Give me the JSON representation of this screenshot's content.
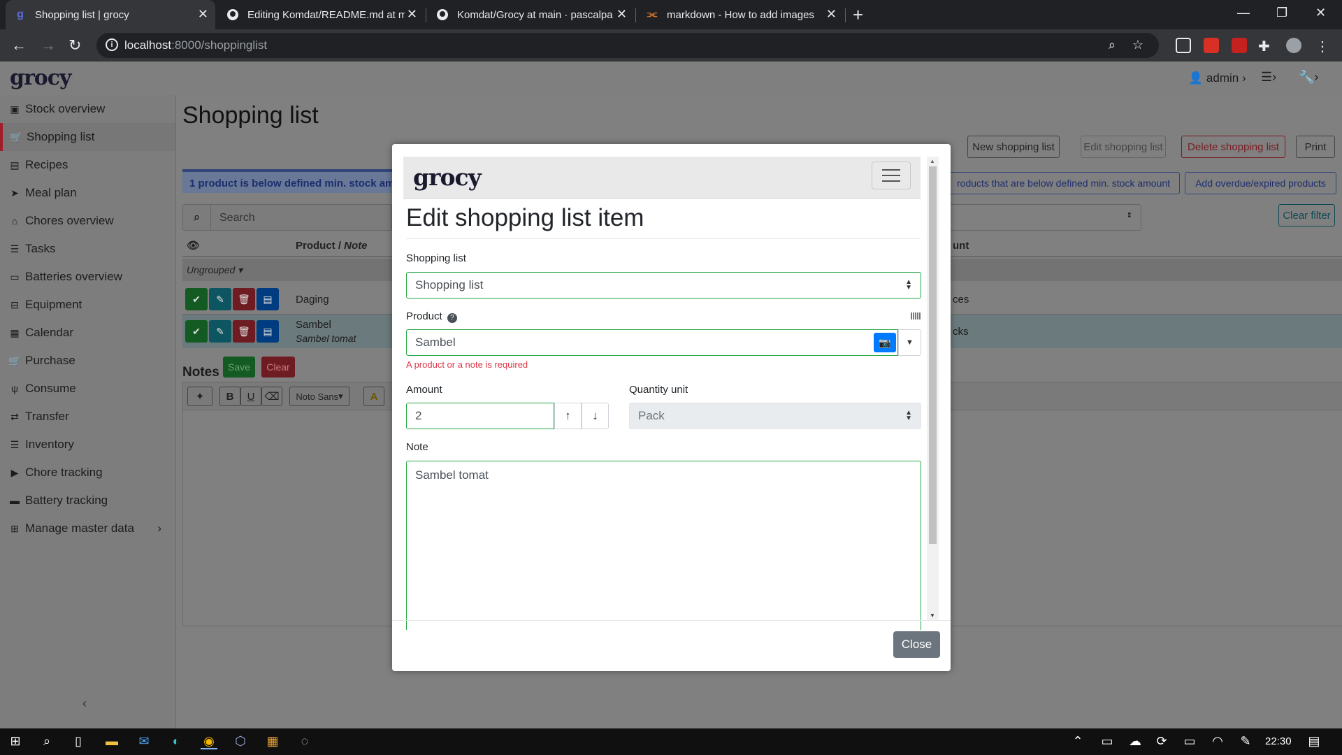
{
  "browser": {
    "tabs": [
      {
        "title": "Shopping list | grocy",
        "favicon": "g"
      },
      {
        "title": "Editing Komdat/README.md at m",
        "favicon": "github"
      },
      {
        "title": "Komdat/Grocy at main · pascalpa",
        "favicon": "github"
      },
      {
        "title": "markdown - How to add images",
        "favicon": "stackoverflow"
      }
    ],
    "url_host": "localhost",
    "url_path": ":8000/shoppinglist"
  },
  "app": {
    "logo": "grocy",
    "user": "admin"
  },
  "sidebar": {
    "items": [
      {
        "label": "Stock overview",
        "icon": "box-icon"
      },
      {
        "label": "Shopping list",
        "icon": "cart-icon"
      },
      {
        "label": "Recipes",
        "icon": "book-icon"
      },
      {
        "label": "Meal plan",
        "icon": "paper-plane-icon"
      },
      {
        "label": "Chores overview",
        "icon": "home-icon"
      },
      {
        "label": "Tasks",
        "icon": "list-icon"
      },
      {
        "label": "Batteries overview",
        "icon": "battery-icon"
      },
      {
        "label": "Equipment",
        "icon": "toolbox-icon"
      },
      {
        "label": "Calendar",
        "icon": "calendar-icon"
      },
      {
        "label": "Purchase",
        "icon": "cart-plus-icon"
      },
      {
        "label": "Consume",
        "icon": "utensils-icon"
      },
      {
        "label": "Transfer",
        "icon": "exchange-icon"
      },
      {
        "label": "Inventory",
        "icon": "list-icon"
      },
      {
        "label": "Chore tracking",
        "icon": "play-icon"
      },
      {
        "label": "Battery tracking",
        "icon": "car-battery-icon"
      },
      {
        "label": "Manage master data",
        "icon": "table-icon"
      }
    ]
  },
  "main": {
    "title": "Shopping list",
    "buttons": {
      "new": "New shopping list",
      "edit": "Edit shopping list",
      "delete": "Delete shopping list",
      "print": "Print",
      "add_below_min": "roducts that are below defined min. stock amount",
      "add_overdue": "Add overdue/expired products",
      "clear_filter": "Clear filter"
    },
    "alert": "1 product is below defined min. stock amou",
    "search_placeholder": "Search",
    "table": {
      "col_product": "Product / ",
      "col_note": "Note",
      "col_amount": "unt",
      "group": "Ungrouped",
      "rows": [
        {
          "product": "Daging",
          "note": "",
          "amount": "ces"
        },
        {
          "product": "Sambel",
          "note": "Sambel tomat",
          "amount": "cks"
        }
      ]
    },
    "notes": {
      "title": "Notes",
      "save": "Save",
      "clear": "Clear",
      "font": "Noto Sans"
    }
  },
  "modal": {
    "logo": "grocy",
    "title": "Edit shopping list item",
    "shopping_list_label": "Shopping list",
    "shopping_list_value": "Shopping list",
    "product_label": "Product",
    "product_value": "Sambel",
    "product_error": "A product or a note is required",
    "amount_label": "Amount",
    "amount_value": "2",
    "qu_label": "Quantity unit",
    "qu_value": "Pack",
    "note_label": "Note",
    "note_value": "Sambel tomat",
    "close": "Close"
  },
  "taskbar": {
    "time": "22:30"
  },
  "colors": {
    "success": "#28a745",
    "danger": "#dc3545",
    "primary": "#007bff",
    "info": "#17a2b8",
    "secondary": "#6c757d"
  }
}
